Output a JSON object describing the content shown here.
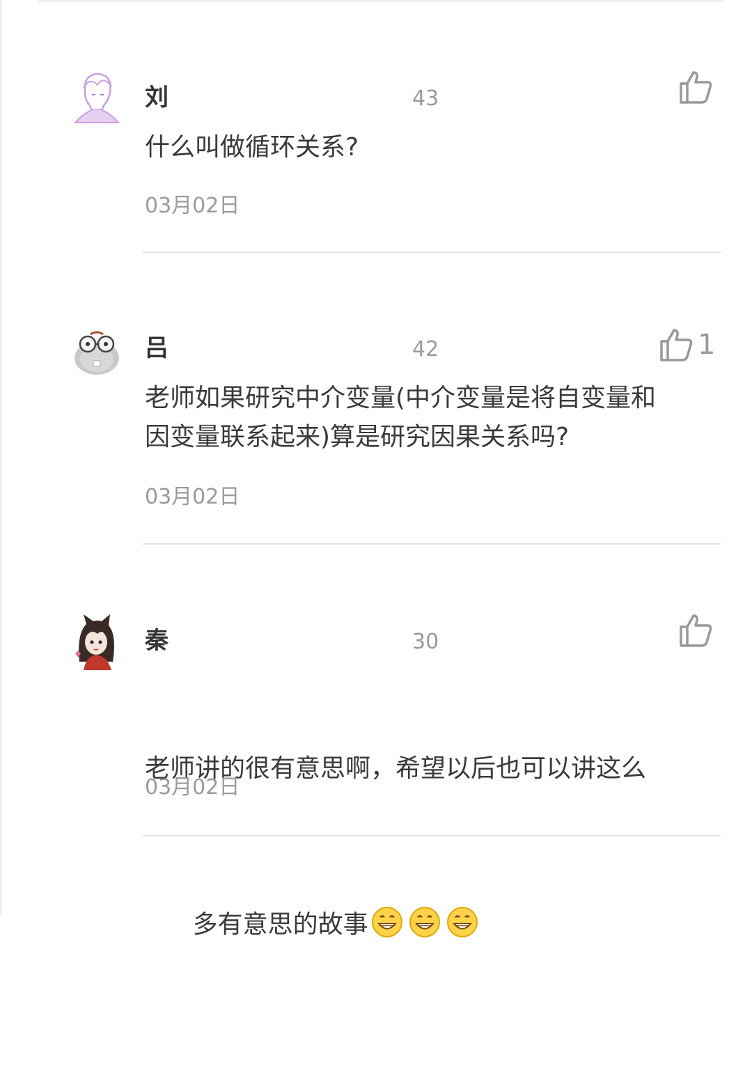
{
  "comments": [
    {
      "author": "刘",
      "count": "43",
      "text": "什么叫做循环关系?",
      "date": "03月02日",
      "likes": "",
      "avatar_icon": "anime-boy-avatar",
      "avatar_color": "#c8a0e0"
    },
    {
      "author": "吕",
      "count": "42",
      "text": "老师如果研究中介变量(中介变量是将自变量和\n因变量联系起来)算是研究因果关系吗?",
      "date": "03月02日",
      "likes": "1",
      "avatar_icon": "hamster-glasses-avatar",
      "avatar_color": "#bdbdbd"
    },
    {
      "author": "秦",
      "count": "30",
      "text_line1": "老师讲的很有意思啊，希望以后也可以讲这么",
      "text_line2": "多有意思的故事",
      "date": "03月02日",
      "likes": "",
      "emojis": [
        "grin-emoji",
        "grin-emoji",
        "grin-emoji"
      ],
      "avatar_icon": "cat-ear-girl-avatar",
      "avatar_color": "#c0392b"
    }
  ]
}
